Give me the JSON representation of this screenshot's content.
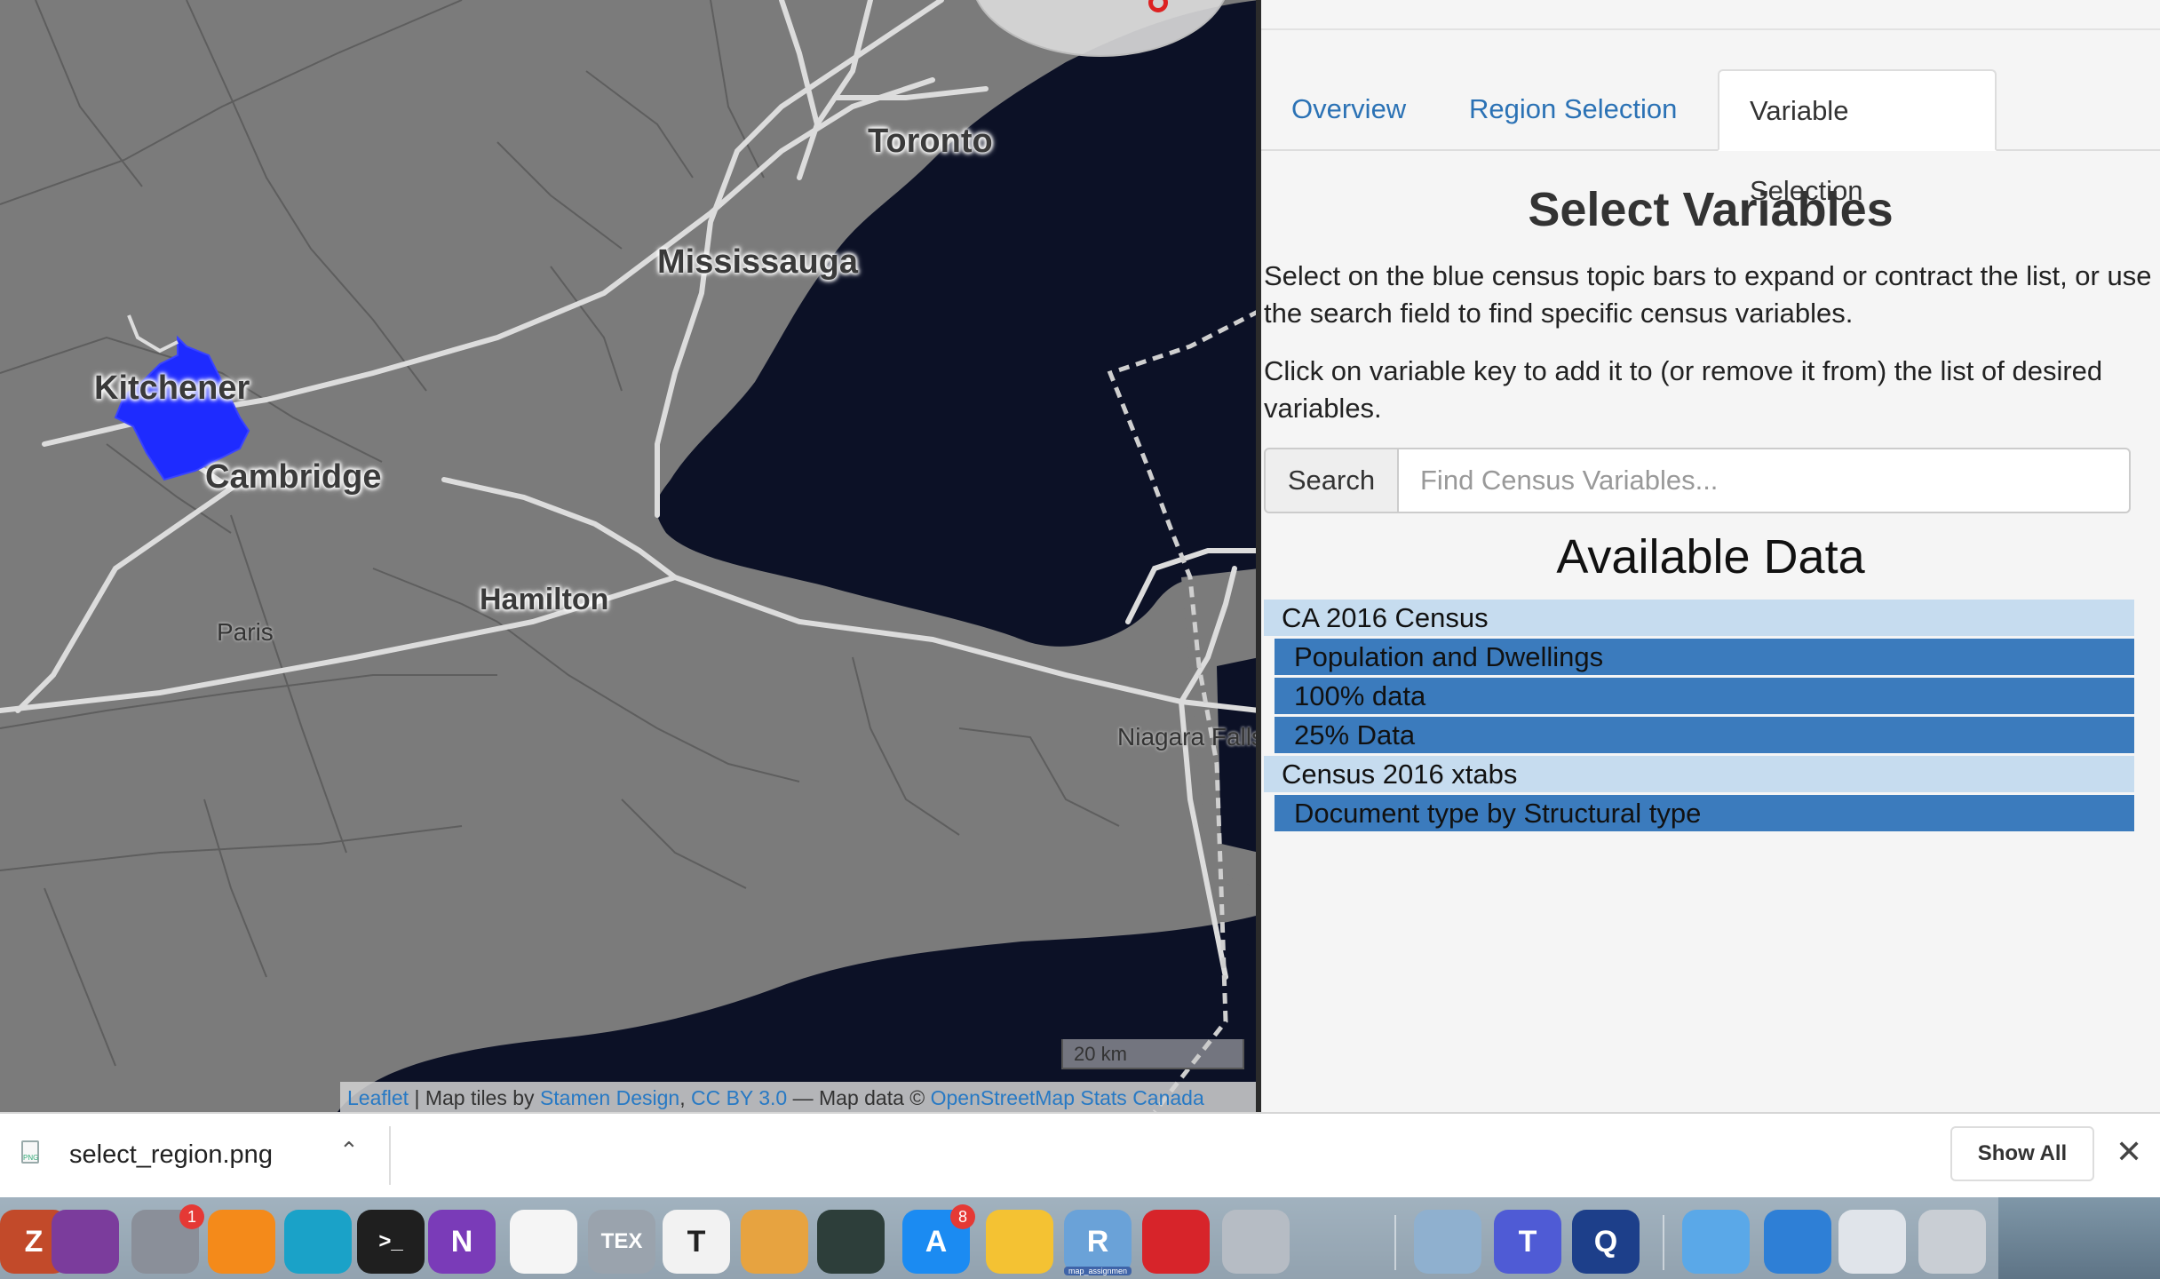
{
  "map": {
    "cities": {
      "toronto": "Toronto",
      "mississauga": "Mississauga",
      "kitchener": "Kitchener",
      "cambridge": "Cambridge",
      "hamilton": "Hamilton",
      "paris": "Paris",
      "niagara_falls": "Niagara Falls"
    },
    "scale_label": "20 km",
    "attribution": {
      "leaflet": "Leaflet",
      "tiles_prefix": " | Map tiles by ",
      "stamen": "Stamen Design",
      "comma": ", ",
      "license": "CC BY 3.0",
      "data_prefix": " — Map data © ",
      "osm": "OpenStreetMap",
      "space": " ",
      "statcan": "Stats Canada"
    },
    "colors": {
      "land": "#7b7b7b",
      "water": "#0c1126",
      "selected_region": "#1e2bff"
    }
  },
  "tabs": [
    {
      "label": "Overview",
      "active": false
    },
    {
      "label": "Region Selection",
      "active": false
    },
    {
      "label": "Variable Selection",
      "active": true
    }
  ],
  "variables": {
    "title": "Select Variables",
    "instructions_1": "Select on the blue census topic bars to expand or contract the list, or use the search field to find specific census variables.",
    "instructions_2": "Click on variable key to add it to (or remove it from) the list of desired variables.",
    "search_label": "Search",
    "search_placeholder": "Find Census Variables...",
    "search_value": "",
    "available_title": "Available Data",
    "tree": [
      {
        "label": "CA 2016 Census",
        "level": 0
      },
      {
        "label": "Population and Dwellings",
        "level": 1
      },
      {
        "label": "100% data",
        "level": 1
      },
      {
        "label": "25% Data",
        "level": 1
      },
      {
        "label": "Census 2016 xtabs",
        "level": 0
      },
      {
        "label": "Document type by Structural type",
        "level": 1
      }
    ]
  },
  "download_bar": {
    "file_name": "select_region.png",
    "file_type": "PNG",
    "show_all": "Show All"
  },
  "dock": {
    "apps": [
      {
        "name": "zotero-icon",
        "letter": "Z"
      },
      {
        "name": "github-desktop-icon",
        "letter": ""
      },
      {
        "name": "system-preferences-icon",
        "letter": "",
        "badge": "1"
      },
      {
        "name": "vlc-icon",
        "letter": ""
      },
      {
        "name": "magnifier-app-icon",
        "letter": ""
      },
      {
        "name": "terminal-icon",
        "letter": ">_"
      },
      {
        "name": "onenote-icon",
        "letter": "N"
      },
      {
        "name": "photos-icon",
        "letter": ""
      },
      {
        "name": "tex-icon",
        "letter": "TEX"
      },
      {
        "name": "typora-icon",
        "letter": "T"
      },
      {
        "name": "mosaic-app-icon",
        "letter": ""
      },
      {
        "name": "time-machine-icon",
        "letter": ""
      },
      {
        "name": "app-store-icon",
        "letter": "A",
        "badge": "8"
      },
      {
        "name": "audio-app-icon",
        "letter": ""
      },
      {
        "name": "r-icon",
        "letter": "R",
        "caption": "map_assignmen"
      },
      {
        "name": "keychain-icon",
        "letter": ""
      },
      {
        "name": "automator-icon",
        "letter": ""
      },
      {
        "name": "preview-icon",
        "letter": ""
      },
      {
        "name": "teams-icon",
        "letter": "T"
      },
      {
        "name": "quicktime-icon",
        "letter": "Q"
      },
      {
        "name": "downloads-folder-icon",
        "letter": ""
      },
      {
        "name": "network-globe-icon",
        "letter": ""
      },
      {
        "name": "finder-window-icon",
        "letter": ""
      },
      {
        "name": "trash-icon",
        "letter": ""
      }
    ]
  }
}
